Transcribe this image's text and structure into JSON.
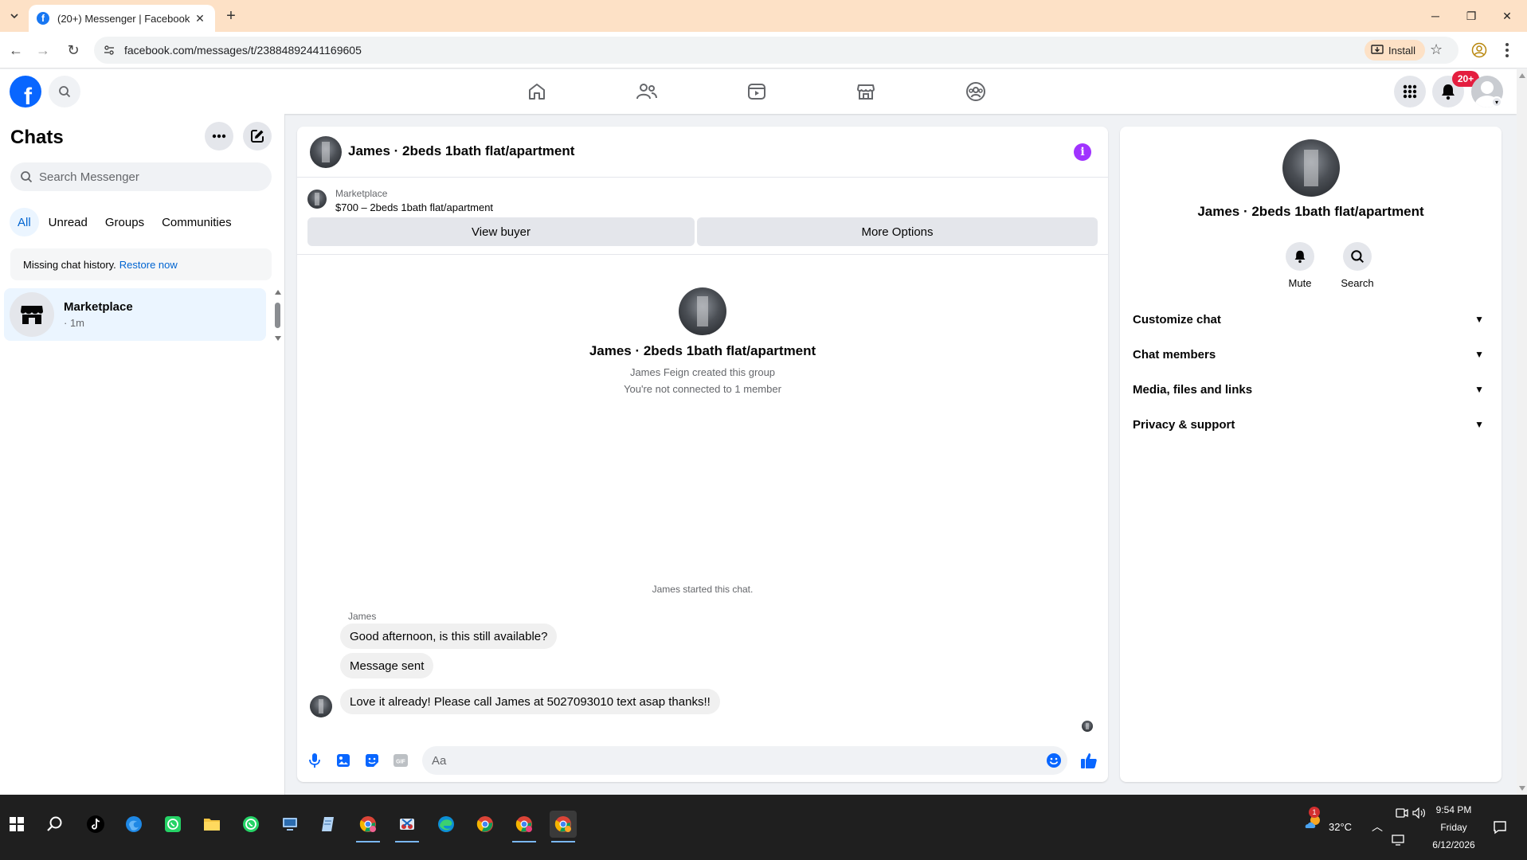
{
  "browser": {
    "tab_title": "(20+) Messenger | Facebook",
    "url": "facebook.com/messages/t/23884892441169605",
    "install_label": "Install"
  },
  "fbnav": {
    "notification_badge": "20+"
  },
  "left": {
    "title": "Chats",
    "search_placeholder": "Search Messenger",
    "filters": [
      "All",
      "Unread",
      "Groups",
      "Communities"
    ],
    "restore_text": "Missing chat history.",
    "restore_link": "Restore now",
    "chat_items": [
      {
        "name": "Marketplace",
        "time": "· 1m"
      }
    ]
  },
  "conversation": {
    "title": "James · 2beds 1bath flat/apartment",
    "marketplace_label": "Marketplace",
    "listing": "$700 – 2beds 1bath flat/apartment",
    "view_buyer_label": "View buyer",
    "more_options_label": "More Options",
    "intro_title": "James · 2beds 1bath flat/apartment",
    "intro_created": "James Feign created this group",
    "intro_connection": "You're not connected to 1 member",
    "system_message": "James started this chat.",
    "sender": "James",
    "messages": [
      "Good afternoon, is this still available?",
      "Message sent",
      "Love it already! Please call James at 5027093010 text asap thanks!!"
    ],
    "composer_placeholder": "Aa"
  },
  "details": {
    "title": "James · 2beds 1bath flat/apartment",
    "mute_label": "Mute",
    "search_label": "Search",
    "sections": [
      "Customize chat",
      "Chat members",
      "Media, files and links",
      "Privacy & support"
    ]
  },
  "taskbar": {
    "weather_temp": "32°C",
    "weather_alert": "1",
    "time": "9:54 PM",
    "day": "Friday",
    "date": "6/12/2026"
  },
  "colors": {
    "fb_blue": "#0866ff",
    "messenger_accent": "#a033ff",
    "active_filter_bg": "#ebf5ff",
    "badge_red": "#e41e3f"
  }
}
